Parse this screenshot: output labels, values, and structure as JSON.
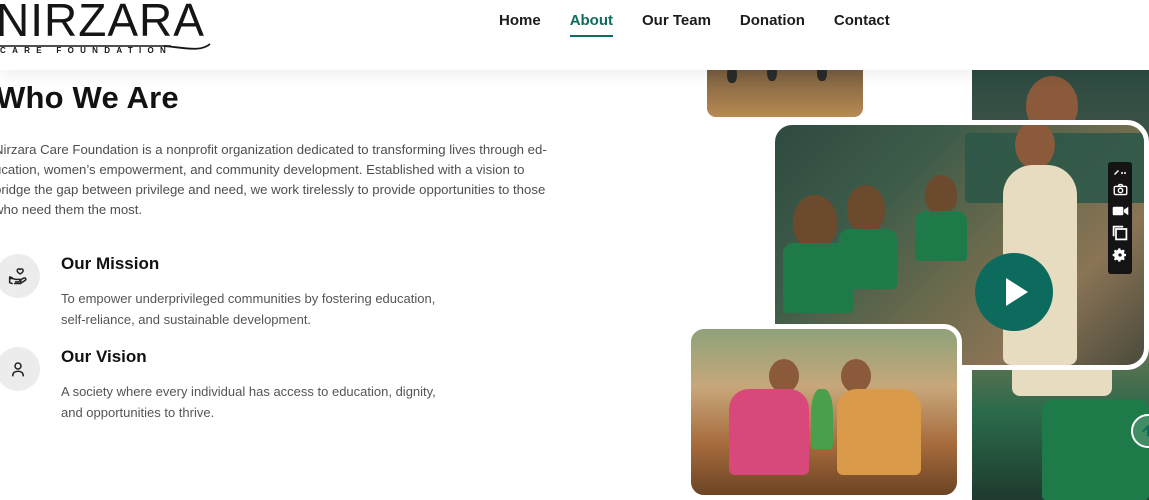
{
  "header": {
    "logo": {
      "name": "NIRZARA",
      "tagline": "CARE FOUNDATION"
    },
    "nav": [
      {
        "label": "Home",
        "active": false
      },
      {
        "label": "About",
        "active": true
      },
      {
        "label": "Our Team",
        "active": false
      },
      {
        "label": "Donation",
        "active": false
      },
      {
        "label": "Contact",
        "active": false
      }
    ]
  },
  "about": {
    "title": "Who We Are",
    "intro": "Nirzara Care Foundation is a nonprofit organization dedicated to transforming lives through education, women's empowerment, and community development. Established with a vision to bridge the gap between privilege and need, we work tirelessly to provide opportunities to those who need them the most.",
    "intro_lines": [
      "Nirzara Care Foundation is a nonprofit organization dedicated to transforming lives through ed-",
      "ucation, women’s empowerment, and community development. Established with a vision to",
      "bridge the gap between privilege and need, we work tirelessly to provide opportunities to those",
      "who need them the most."
    ],
    "items": [
      {
        "icon": "hand-heart-icon",
        "title": "Our Mission",
        "lines": [
          "To empower underprivileged communities by fostering education,",
          "self-reliance, and sustainable development."
        ]
      },
      {
        "icon": "person-icon",
        "title": "Our Vision",
        "lines": [
          "A society where every individual has access to education, dignity,",
          "and opportunities to thrive."
        ]
      }
    ]
  },
  "media": {
    "play_icon": "play-icon",
    "accent": "#0d6b5e"
  },
  "toolbar": {
    "icons": [
      "pen-icon",
      "camera-icon",
      "video-icon",
      "window-icon",
      "gear-icon"
    ]
  },
  "scroll_top_icon": "arrow-up-icon",
  "colors": {
    "accent": "#0f6b5c",
    "text": "#121212",
    "muted": "#555555"
  }
}
